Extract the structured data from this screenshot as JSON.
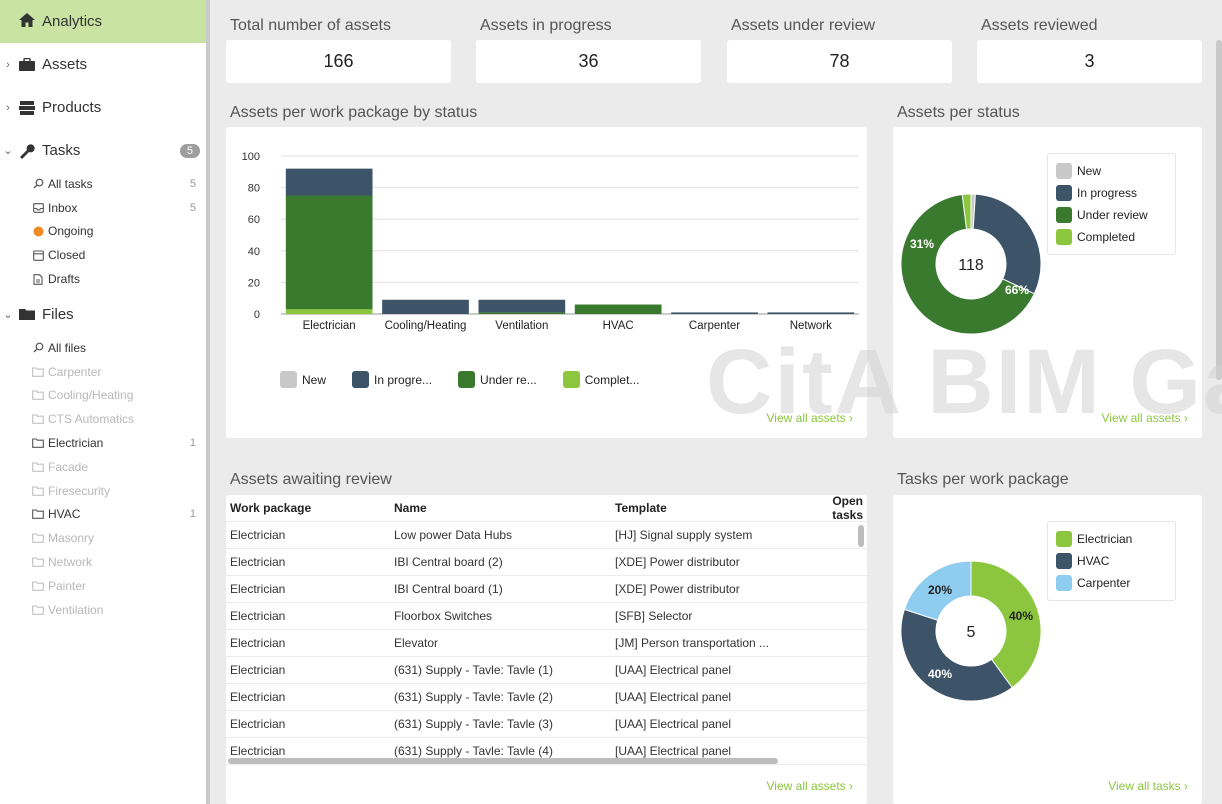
{
  "sidebar": {
    "analytics": "Analytics",
    "assets": "Assets",
    "products": "Products",
    "tasks": "Tasks",
    "tasks_badge": "5",
    "task_items": [
      {
        "label": "All tasks",
        "count": "5",
        "icon": "search-icon"
      },
      {
        "label": "Inbox",
        "count": "5",
        "icon": "inbox-icon"
      },
      {
        "label": "Ongoing",
        "count": "",
        "icon": "orange-dot-icon"
      },
      {
        "label": "Closed",
        "count": "",
        "icon": "calendar-icon"
      },
      {
        "label": "Drafts",
        "count": "",
        "icon": "document-icon"
      }
    ],
    "files": "Files",
    "file_items": [
      {
        "label": "All files",
        "count": "",
        "dim": false,
        "icon": "search-icon"
      },
      {
        "label": "Carpenter",
        "count": "",
        "dim": true
      },
      {
        "label": "Cooling/Heating",
        "count": "",
        "dim": true
      },
      {
        "label": "CTS Automatics",
        "count": "",
        "dim": true
      },
      {
        "label": "Electrician",
        "count": "1",
        "dim": false
      },
      {
        "label": "Facade",
        "count": "",
        "dim": true
      },
      {
        "label": "Firesecurity",
        "count": "",
        "dim": true
      },
      {
        "label": "HVAC",
        "count": "1",
        "dim": false
      },
      {
        "label": "Masonry",
        "count": "",
        "dim": true
      },
      {
        "label": "Network",
        "count": "",
        "dim": true
      },
      {
        "label": "Painter",
        "count": "",
        "dim": true
      },
      {
        "label": "Ventilation",
        "count": "",
        "dim": true
      }
    ]
  },
  "stats": [
    {
      "label": "Total number of assets",
      "value": "166"
    },
    {
      "label": "Assets in progress",
      "value": "36"
    },
    {
      "label": "Assets under review",
      "value": "78"
    },
    {
      "label": "Assets reviewed",
      "value": "3"
    }
  ],
  "bar_section": {
    "title": "Assets per work package by status",
    "link": "View all assets ›",
    "legend": [
      {
        "label": "New",
        "color": "#c8c8c8"
      },
      {
        "label": "In progre...",
        "color": "#3d5468"
      },
      {
        "label": "Under re...",
        "color": "#3a7a2e"
      },
      {
        "label": "Complet...",
        "color": "#8cc63f"
      }
    ]
  },
  "status_section": {
    "title": "Assets per status",
    "link": "View all assets ›",
    "center": "118",
    "label_in_progress": "31%",
    "label_under_review": "66%",
    "legend": [
      {
        "label": "New",
        "color": "#c8c8c8"
      },
      {
        "label": "In progress",
        "color": "#3d5468"
      },
      {
        "label": "Under review",
        "color": "#3a7a2e"
      },
      {
        "label": "Completed",
        "color": "#8cc63f"
      }
    ]
  },
  "review_section": {
    "title": "Assets awaiting review",
    "link": "View all assets ›",
    "columns": [
      "Work package",
      "Name",
      "Template",
      "Open tasks"
    ],
    "rows": [
      [
        "Electrician",
        "Low power Data Hubs",
        "[HJ] Signal supply system",
        ""
      ],
      [
        "Electrician",
        "IBI Central board (2)",
        "[XDE] Power distributor",
        ""
      ],
      [
        "Electrician",
        "IBI Central board (1)",
        "[XDE] Power distributor",
        ""
      ],
      [
        "Electrician",
        "Floorbox Switches",
        "[SFB] Selector",
        ""
      ],
      [
        "Electrician",
        "Elevator",
        "[JM] Person transportation ...",
        ""
      ],
      [
        "Electrician",
        "(631) Supply - Tavle: Tavle (1)",
        "[UAA] Electrical panel",
        ""
      ],
      [
        "Electrician",
        "(631) Supply - Tavle: Tavle (2)",
        "[UAA] Electrical panel",
        ""
      ],
      [
        "Electrician",
        "(631) Supply - Tavle: Tavle (3)",
        "[UAA] Electrical panel",
        ""
      ],
      [
        "Electrician",
        "(631) Supply - Tavle: Tavle (4)",
        "[UAA] Electrical panel",
        ""
      ]
    ]
  },
  "tasks_section": {
    "title": "Tasks per work package",
    "link": "View all tasks ›",
    "center": "5",
    "labels": {
      "electrician": "40%",
      "hvac": "40%",
      "carpenter": "20%"
    },
    "legend": [
      {
        "label": "Electrician",
        "color": "#8cc63f"
      },
      {
        "label": "HVAC",
        "color": "#3d5468"
      },
      {
        "label": "Carpenter",
        "color": "#8ecdf0"
      }
    ]
  },
  "watermark": "CitA BIM Ga",
  "chart_data": [
    {
      "type": "bar",
      "stacked": true,
      "categories": [
        "Electrician",
        "Cooling/Heating",
        "Ventilation",
        "HVAC",
        "Carpenter",
        "Network"
      ],
      "series": [
        {
          "name": "New",
          "values": [
            0,
            0,
            0,
            0,
            0,
            0
          ]
        },
        {
          "name": "In progress",
          "values": [
            17,
            9,
            8,
            0,
            1,
            1
          ]
        },
        {
          "name": "Under review",
          "values": [
            72,
            0,
            1,
            6,
            0,
            0
          ]
        },
        {
          "name": "Completed",
          "values": [
            3,
            0,
            0,
            0,
            0,
            0
          ]
        }
      ],
      "yticks": [
        0,
        20,
        40,
        60,
        80,
        100
      ],
      "ylim": [
        0,
        100
      ],
      "grid": true,
      "legend": "bottom"
    },
    {
      "type": "pie",
      "donut": true,
      "center_label": "118",
      "labels": [
        "New",
        "In progress",
        "Under review",
        "Completed"
      ],
      "values": [
        1,
        31,
        66,
        2
      ]
    },
    {
      "type": "pie",
      "donut": true,
      "center_label": "5",
      "labels": [
        "Electrician",
        "HVAC",
        "Carpenter"
      ],
      "values": [
        40,
        40,
        20
      ]
    }
  ]
}
